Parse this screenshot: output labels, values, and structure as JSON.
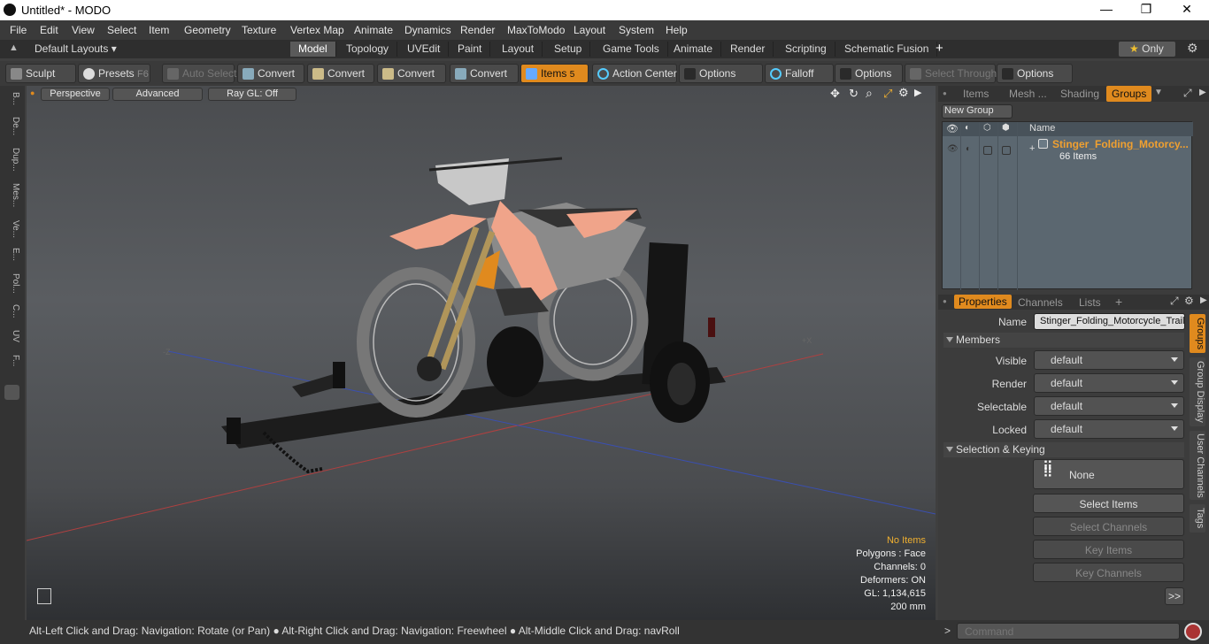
{
  "window": {
    "title": "Untitled* - MODO",
    "minimize": "—",
    "maximize": "❐",
    "close": "✕"
  },
  "menu": [
    "File",
    "Edit",
    "View",
    "Select",
    "Item",
    "Geometry",
    "Texture",
    "Vertex Map",
    "Animate",
    "Dynamics",
    "Render",
    "MaxToModo",
    "Layout",
    "System",
    "Help"
  ],
  "layoutbar": {
    "layouts_label": "Default Layouts",
    "tabs": [
      "Model",
      "Topology",
      "UVEdit",
      "Paint",
      "Layout",
      "Setup",
      "Game Tools",
      "Animate",
      "Render",
      "Scripting",
      "Schematic Fusion"
    ],
    "add": "+",
    "only": "Only",
    "active_tab": "Model"
  },
  "toolbar": {
    "sculpt": "Sculpt",
    "presets": "Presets",
    "presets_key": "F6",
    "auto_select": "Auto Select",
    "convert1": "Convert",
    "convert2": "Convert",
    "convert3": "Convert",
    "convert4": "Convert",
    "items": "Items",
    "items_key": "5",
    "action_center": "Action Center",
    "options1": "Options",
    "falloff": "Falloff",
    "options2": "Options",
    "select_through": "Select Through",
    "options3": "Options"
  },
  "leftstrip": [
    "B...",
    "De...",
    "Dup...",
    "Mes...",
    "Ve...",
    "E...",
    "Pol...",
    "C...",
    "UV",
    "F..."
  ],
  "viewport": {
    "perspective": "Perspective",
    "advanced": "Advanced",
    "raygl": "Ray GL: Off",
    "axis_neg_z": "-Z",
    "axis_pos_x": "+X",
    "info": {
      "items": "No Items",
      "polygons": "Polygons : Face",
      "channels": "Channels: 0",
      "deformers": "Deformers: ON",
      "gl": "GL: 1,134,615",
      "scale": "200 mm"
    }
  },
  "groups_panel": {
    "tabs": [
      "Items",
      "Mesh ...",
      "Shading",
      "Groups"
    ],
    "active": "Groups",
    "new_group": "New Group",
    "col_name": "Name",
    "group_name": "Stinger_Folding_Motorcy...",
    "group_count": "66 Items"
  },
  "properties": {
    "tabs": [
      "Properties",
      "Channels",
      "Lists"
    ],
    "add": "+",
    "name_label": "Name",
    "name_value": "Stinger_Folding_Motorcycle_Trail",
    "members": "Members",
    "visible_label": "Visible",
    "visible": "default",
    "render_label": "Render",
    "render": "default",
    "selectable_label": "Selectable",
    "selectable": "default",
    "locked_label": "Locked",
    "locked": "default",
    "sel_keying": "Selection & Keying",
    "none": "None",
    "select_items": "Select Items",
    "select_channels": "Select Channels",
    "key_items": "Key Items",
    "key_channels": "Key Channels",
    "more": ">>",
    "side_tabs": [
      "Groups",
      "Group Display",
      "User Channels",
      "Tags"
    ]
  },
  "status": {
    "hint": "Alt-Left Click and Drag: Navigation: Rotate (or Pan) ● Alt-Right Click and Drag: Navigation: Freewheel ● Alt-Middle Click and Drag: navRoll"
  },
  "command": {
    "placeholder": "Command",
    "prompt": ">"
  },
  "colors": {
    "accent": "#e08a1e",
    "group_text": "#f0a030"
  }
}
